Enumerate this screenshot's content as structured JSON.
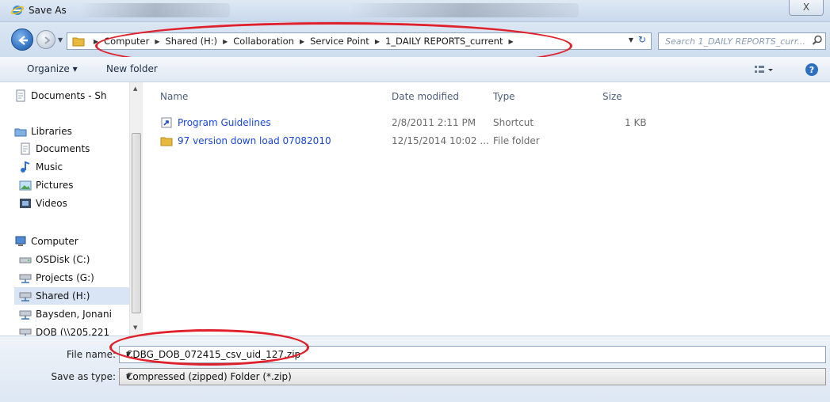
{
  "window": {
    "title": "Save As",
    "close_glyph": "X"
  },
  "address": {
    "crumbs": [
      "Computer",
      "Shared (H:)",
      "Collaboration",
      "Service Point",
      "1_DAILY REPORTS_current"
    ]
  },
  "search": {
    "placeholder": "Search 1_DAILY REPORTS_curr..."
  },
  "toolbar": {
    "organize": "Organize ▾",
    "new_folder": "New folder"
  },
  "nav": {
    "documents_share": "Documents - Sh",
    "libraries": "Libraries",
    "documents": "Documents",
    "music": "Music",
    "pictures": "Pictures",
    "videos": "Videos",
    "computer": "Computer",
    "osdisk": "OSDisk (C:)",
    "projects": "Projects (G:)",
    "shared": "Shared (H:)",
    "baysden": "Baysden, Jonani",
    "dob": "DOB (\\\\205.221"
  },
  "columns": {
    "name": "Name",
    "date": "Date modified",
    "type": "Type",
    "size": "Size"
  },
  "files": [
    {
      "name": "Program Guidelines",
      "date": "2/8/2011 2:11 PM",
      "type": "Shortcut",
      "size": "1 KB"
    },
    {
      "name": "97 version down load 07082010",
      "date": "12/15/2014 10:02 ...",
      "type": "File folder",
      "size": ""
    }
  ],
  "footer": {
    "file_name_label": "File name:",
    "file_name_value": "CDBG_DOB_072415_csv_uid_127.zip",
    "save_type_label": "Save as type:",
    "save_type_value": "Compressed (zipped) Folder (*.zip)"
  },
  "colors": {
    "highlight": "#e0202a",
    "link": "#1a47d6",
    "selection": "#d9e5f4"
  }
}
